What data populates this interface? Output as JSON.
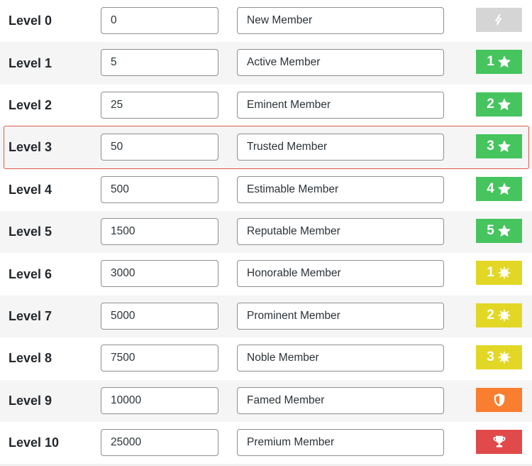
{
  "levels": [
    {
      "label": "Level 0",
      "points": "0",
      "title": "New Member",
      "badge": {
        "number": "",
        "icon": "rank-zero-icon",
        "color": "#d5d5d5"
      }
    },
    {
      "label": "Level 1",
      "points": "5",
      "title": "Active Member",
      "badge": {
        "number": "1",
        "icon": "star-icon",
        "color": "#46c45e"
      }
    },
    {
      "label": "Level 2",
      "points": "25",
      "title": "Eminent Member",
      "badge": {
        "number": "2",
        "icon": "star-icon",
        "color": "#46c45e"
      }
    },
    {
      "label": "Level 3",
      "points": "50",
      "title": "Trusted Member",
      "badge": {
        "number": "3",
        "icon": "star-icon",
        "color": "#46c45e"
      },
      "highlighted": true
    },
    {
      "label": "Level 4",
      "points": "500",
      "title": "Estimable Member",
      "badge": {
        "number": "4",
        "icon": "star-icon",
        "color": "#46c45e"
      }
    },
    {
      "label": "Level 5",
      "points": "1500",
      "title": "Reputable Member",
      "badge": {
        "number": "5",
        "icon": "star-icon",
        "color": "#46c45e"
      }
    },
    {
      "label": "Level 6",
      "points": "3000",
      "title": "Honorable Member",
      "badge": {
        "number": "1",
        "icon": "sun-icon",
        "color": "#e3d726"
      }
    },
    {
      "label": "Level 7",
      "points": "5000",
      "title": "Prominent Member",
      "badge": {
        "number": "2",
        "icon": "sun-icon",
        "color": "#e3d726"
      }
    },
    {
      "label": "Level 8",
      "points": "7500",
      "title": "Noble Member",
      "badge": {
        "number": "3",
        "icon": "sun-icon",
        "color": "#e3d726"
      }
    },
    {
      "label": "Level 9",
      "points": "10000",
      "title": "Famed Member",
      "badge": {
        "number": "",
        "icon": "shield-icon",
        "color": "#f97e2f"
      }
    },
    {
      "label": "Level 10",
      "points": "25000",
      "title": "Premium Member",
      "badge": {
        "number": "",
        "icon": "trophy-icon",
        "color": "#e04a4a"
      }
    }
  ],
  "highlight_color": "#e2564d"
}
